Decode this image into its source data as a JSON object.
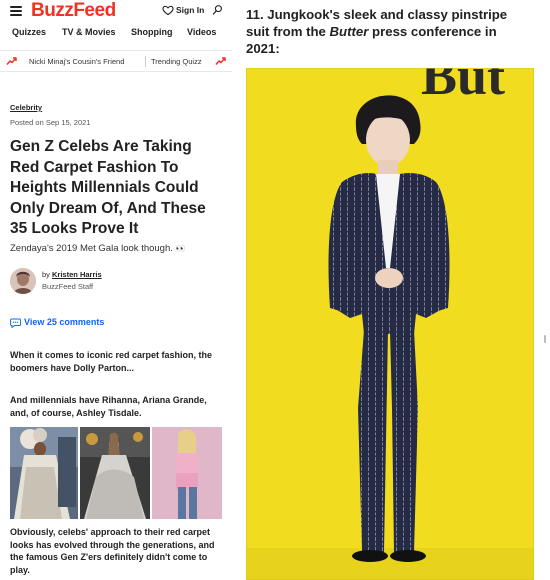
{
  "header": {
    "logo": "BuzzFeed",
    "sign_in": "Sign In"
  },
  "nav": {
    "items": [
      "Quizzes",
      "TV & Movies",
      "Shopping",
      "Videos"
    ]
  },
  "trending": {
    "items": [
      "Nicki Minaj's Cousin's Friend",
      "Trending Quizz"
    ]
  },
  "article": {
    "category": "Celebrity",
    "posted": "Posted on Sep 15, 2021",
    "headline": "Gen Z Celebs Are Taking Red Carpet Fashion To Heights Millennials Could Only Dream Of, And These 35 Looks Prove It",
    "subhead": "Zendaya's 2019 Met Gala look though.",
    "subhead_emoji": "👀",
    "byline_prefix": "by",
    "author": "Kristen Harris",
    "author_role": "BuzzFeed Staff",
    "comments": "View 25 comments",
    "para1": "When it comes to iconic red carpet fashion, the boomers have Dolly Parton...",
    "para2": "And millennials have Rihanna, Ariana Grande, and, of course, Ashley Tisdale.",
    "para3": "Obviously, celebs' approach to their red carpet looks has evolved through the generations, and the famous Gen Z'ers definitely didn't come to play."
  },
  "right_panel": {
    "caption_prefix": "11. Jungkook's sleek and classy pinstripe suit from the",
    "caption_italic": "Butter",
    "caption_suffix": "press conference in 2021:",
    "backdrop_text": "But"
  },
  "colors": {
    "brand": "#ee3322",
    "link": "#0f65ef",
    "backdrop": "#f1dc20"
  }
}
